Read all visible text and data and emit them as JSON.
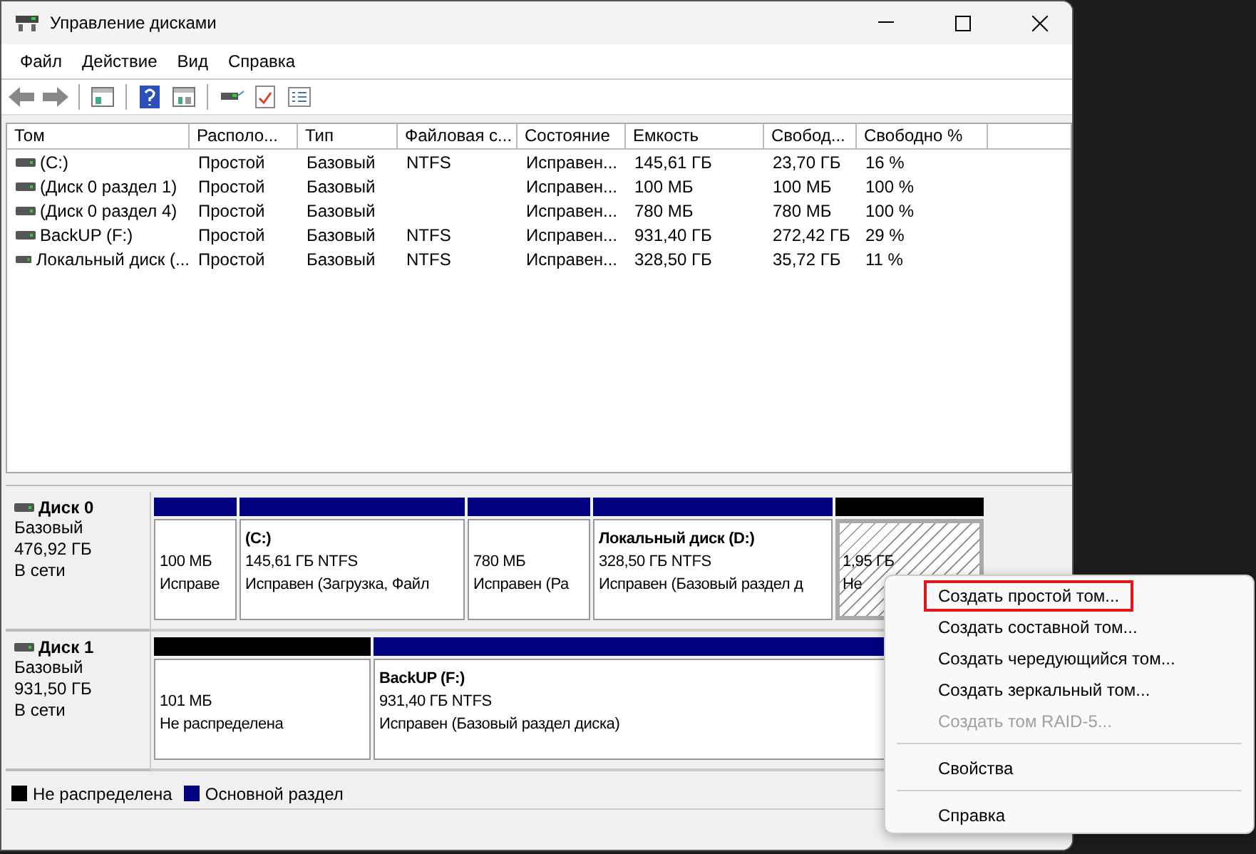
{
  "window": {
    "title": "Управление дисками"
  },
  "menu": [
    "Файл",
    "Действие",
    "Вид",
    "Справка"
  ],
  "table": {
    "columns": [
      "Том",
      "Располо...",
      "Тип",
      "Файловая с...",
      "Состояние",
      "Емкость",
      "Свобод...",
      "Свободно %"
    ],
    "rows": [
      [
        "(C:)",
        "Простой",
        "Базовый",
        "NTFS",
        "Исправен...",
        "145,61 ГБ",
        "23,70 ГБ",
        "16 %"
      ],
      [
        "(Диск 0 раздел 1)",
        "Простой",
        "Базовый",
        "",
        "Исправен...",
        "100 МБ",
        "100 МБ",
        "100 %"
      ],
      [
        "(Диск 0 раздел 4)",
        "Простой",
        "Базовый",
        "",
        "Исправен...",
        "780 МБ",
        "780 МБ",
        "100 %"
      ],
      [
        "BackUP (F:)",
        "Простой",
        "Базовый",
        "NTFS",
        "Исправен...",
        "931,40 ГБ",
        "272,42 ГБ",
        "29 %"
      ],
      [
        "Локальный диск (...",
        "Простой",
        "Базовый",
        "NTFS",
        "Исправен...",
        "328,50 ГБ",
        "35,72 ГБ",
        "11 %"
      ]
    ]
  },
  "disks": [
    {
      "name": "Диск 0",
      "type": "Базовый",
      "size": "476,92 ГБ",
      "status": "В сети",
      "partitions": [
        {
          "kind": "primary",
          "selected": false,
          "size": "100 МБ",
          "status": "Исправе"
        },
        {
          "kind": "primary",
          "selected": false,
          "title": "(C:)",
          "size": "145,61 ГБ NTFS",
          "status": "Исправен (Загрузка, Файл"
        },
        {
          "kind": "primary",
          "selected": false,
          "size": "780 МБ",
          "status": "Исправен (Ра"
        },
        {
          "kind": "primary",
          "selected": false,
          "title": "Локальный диск  (D:)",
          "size": "328,50 ГБ NTFS",
          "status": "Исправен (Базовый раздел д"
        },
        {
          "kind": "unallocated",
          "selected": true,
          "size": "1,95 ГБ",
          "status": "Не"
        }
      ]
    },
    {
      "name": "Диск 1",
      "type": "Базовый",
      "size": "931,50 ГБ",
      "status": "В сети",
      "partitions": [
        {
          "kind": "unallocated",
          "selected": false,
          "size": "101 МБ",
          "status": "Не распределена"
        },
        {
          "kind": "primary",
          "selected": false,
          "title": "BackUP  (F:)",
          "size": "931,40 ГБ NTFS",
          "status": "Исправен (Базовый раздел диска)"
        }
      ]
    }
  ],
  "legend": [
    {
      "label": "Не распределена",
      "color": "#000000"
    },
    {
      "label": "Основной раздел",
      "color": "#000080"
    }
  ],
  "context_menu": [
    {
      "kind": "item",
      "label": "Создать простой том...",
      "selected": true,
      "disabled": false
    },
    {
      "kind": "item",
      "label": "Создать составной том...",
      "selected": false,
      "disabled": false
    },
    {
      "kind": "item",
      "label": "Создать чередующийся том...",
      "selected": false,
      "disabled": false
    },
    {
      "kind": "item",
      "label": "Создать зеркальный том...",
      "selected": false,
      "disabled": false
    },
    {
      "kind": "item",
      "label": "Создать том RAID-5...",
      "selected": false,
      "disabled": true
    },
    {
      "kind": "separator"
    },
    {
      "kind": "item",
      "label": "Свойства",
      "selected": false,
      "disabled": false
    },
    {
      "kind": "separator"
    },
    {
      "kind": "item",
      "label": "Справка",
      "selected": false,
      "disabled": false
    }
  ]
}
